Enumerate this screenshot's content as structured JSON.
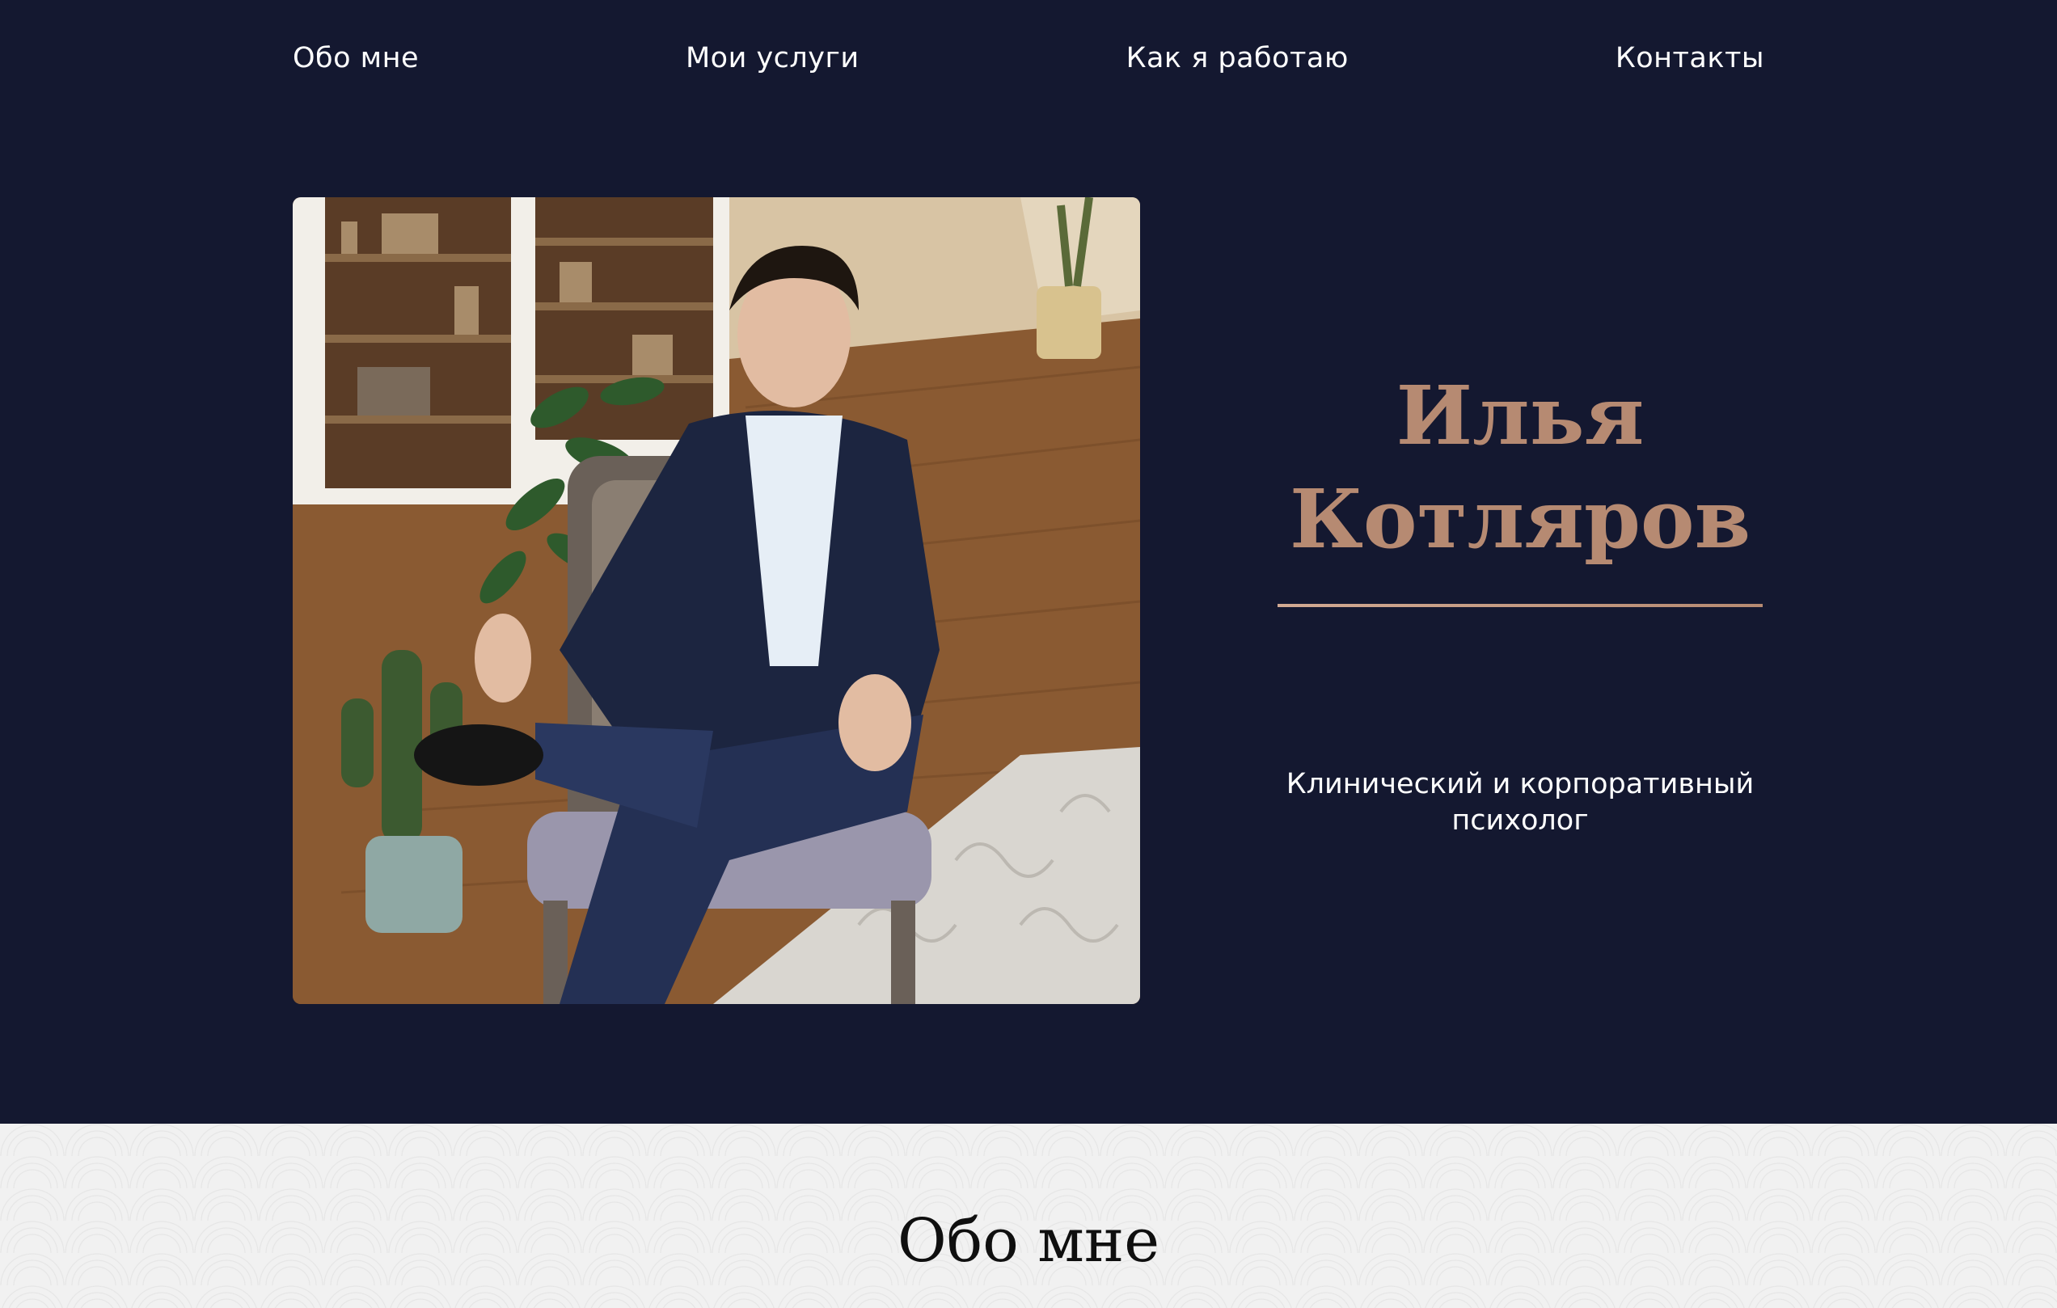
{
  "nav": {
    "items": [
      {
        "label": "Обо мне"
      },
      {
        "label": "Мои услуги"
      },
      {
        "label": "Как я работаю"
      },
      {
        "label": "Контакты"
      }
    ]
  },
  "hero": {
    "name_first": "Илья",
    "name_last": "Котляров",
    "subtitle": "Клинический и корпоративный психолог",
    "photo_alt": "Илья Котляров"
  },
  "about": {
    "title": "Обо мне"
  },
  "colors": {
    "background": "#141830",
    "accent": "#b68a72",
    "text_light": "#ffffff",
    "about_background": "#f1f1f1"
  }
}
